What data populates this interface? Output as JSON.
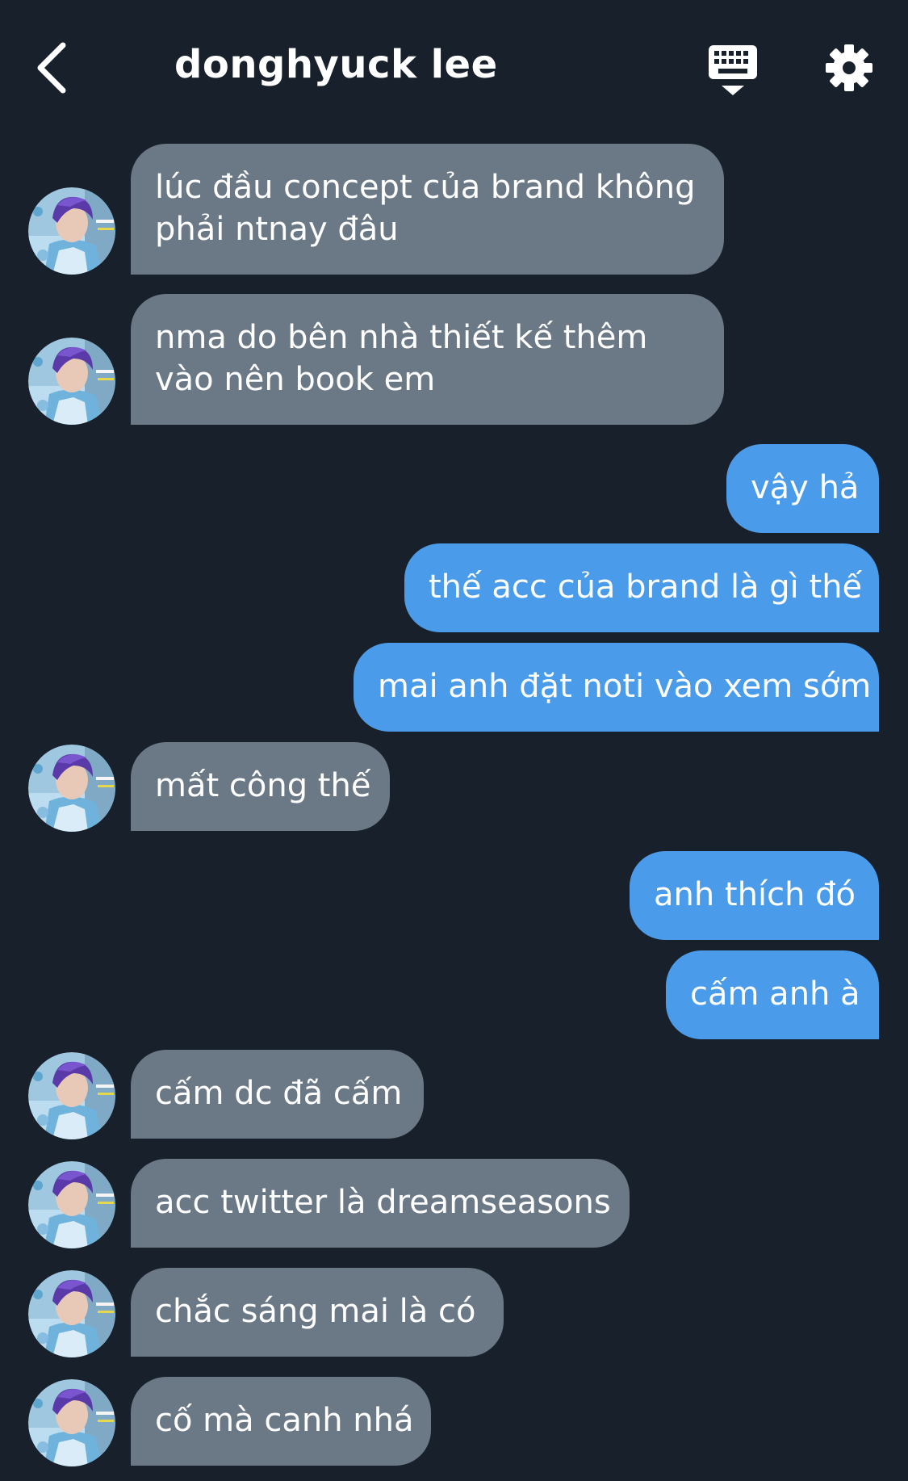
{
  "header": {
    "title": "donghyuck lee",
    "back_icon": "chevron-left-icon",
    "keyboard_icon": "keyboard-icon",
    "settings_icon": "gear-icon"
  },
  "colors": {
    "background": "#18202b",
    "incoming_bubble": "#6b7886",
    "outgoing_bubble": "#4a9be9",
    "text": "#ffffff"
  },
  "messages": [
    {
      "dir": "in",
      "text": "lúc đầu concept của brand không phải ntnay đâu"
    },
    {
      "dir": "in",
      "text": "nma do bên nhà thiết kế thêm vào nên book em"
    },
    {
      "dir": "out",
      "text": "vậy hả"
    },
    {
      "dir": "out",
      "text": "thế acc của brand là gì thế"
    },
    {
      "dir": "out",
      "text": "mai anh đặt noti vào xem sớm"
    },
    {
      "dir": "in",
      "text": "mất công thế"
    },
    {
      "dir": "out",
      "text": "anh thích đó"
    },
    {
      "dir": "out",
      "text": "cấm anh à"
    },
    {
      "dir": "in",
      "text": "cấm dc đã cấm"
    },
    {
      "dir": "in",
      "text": "acc twitter là dreamseasons"
    },
    {
      "dir": "in",
      "text": "chắc sáng mai là có"
    },
    {
      "dir": "in",
      "text": "cố mà canh nhá"
    }
  ]
}
